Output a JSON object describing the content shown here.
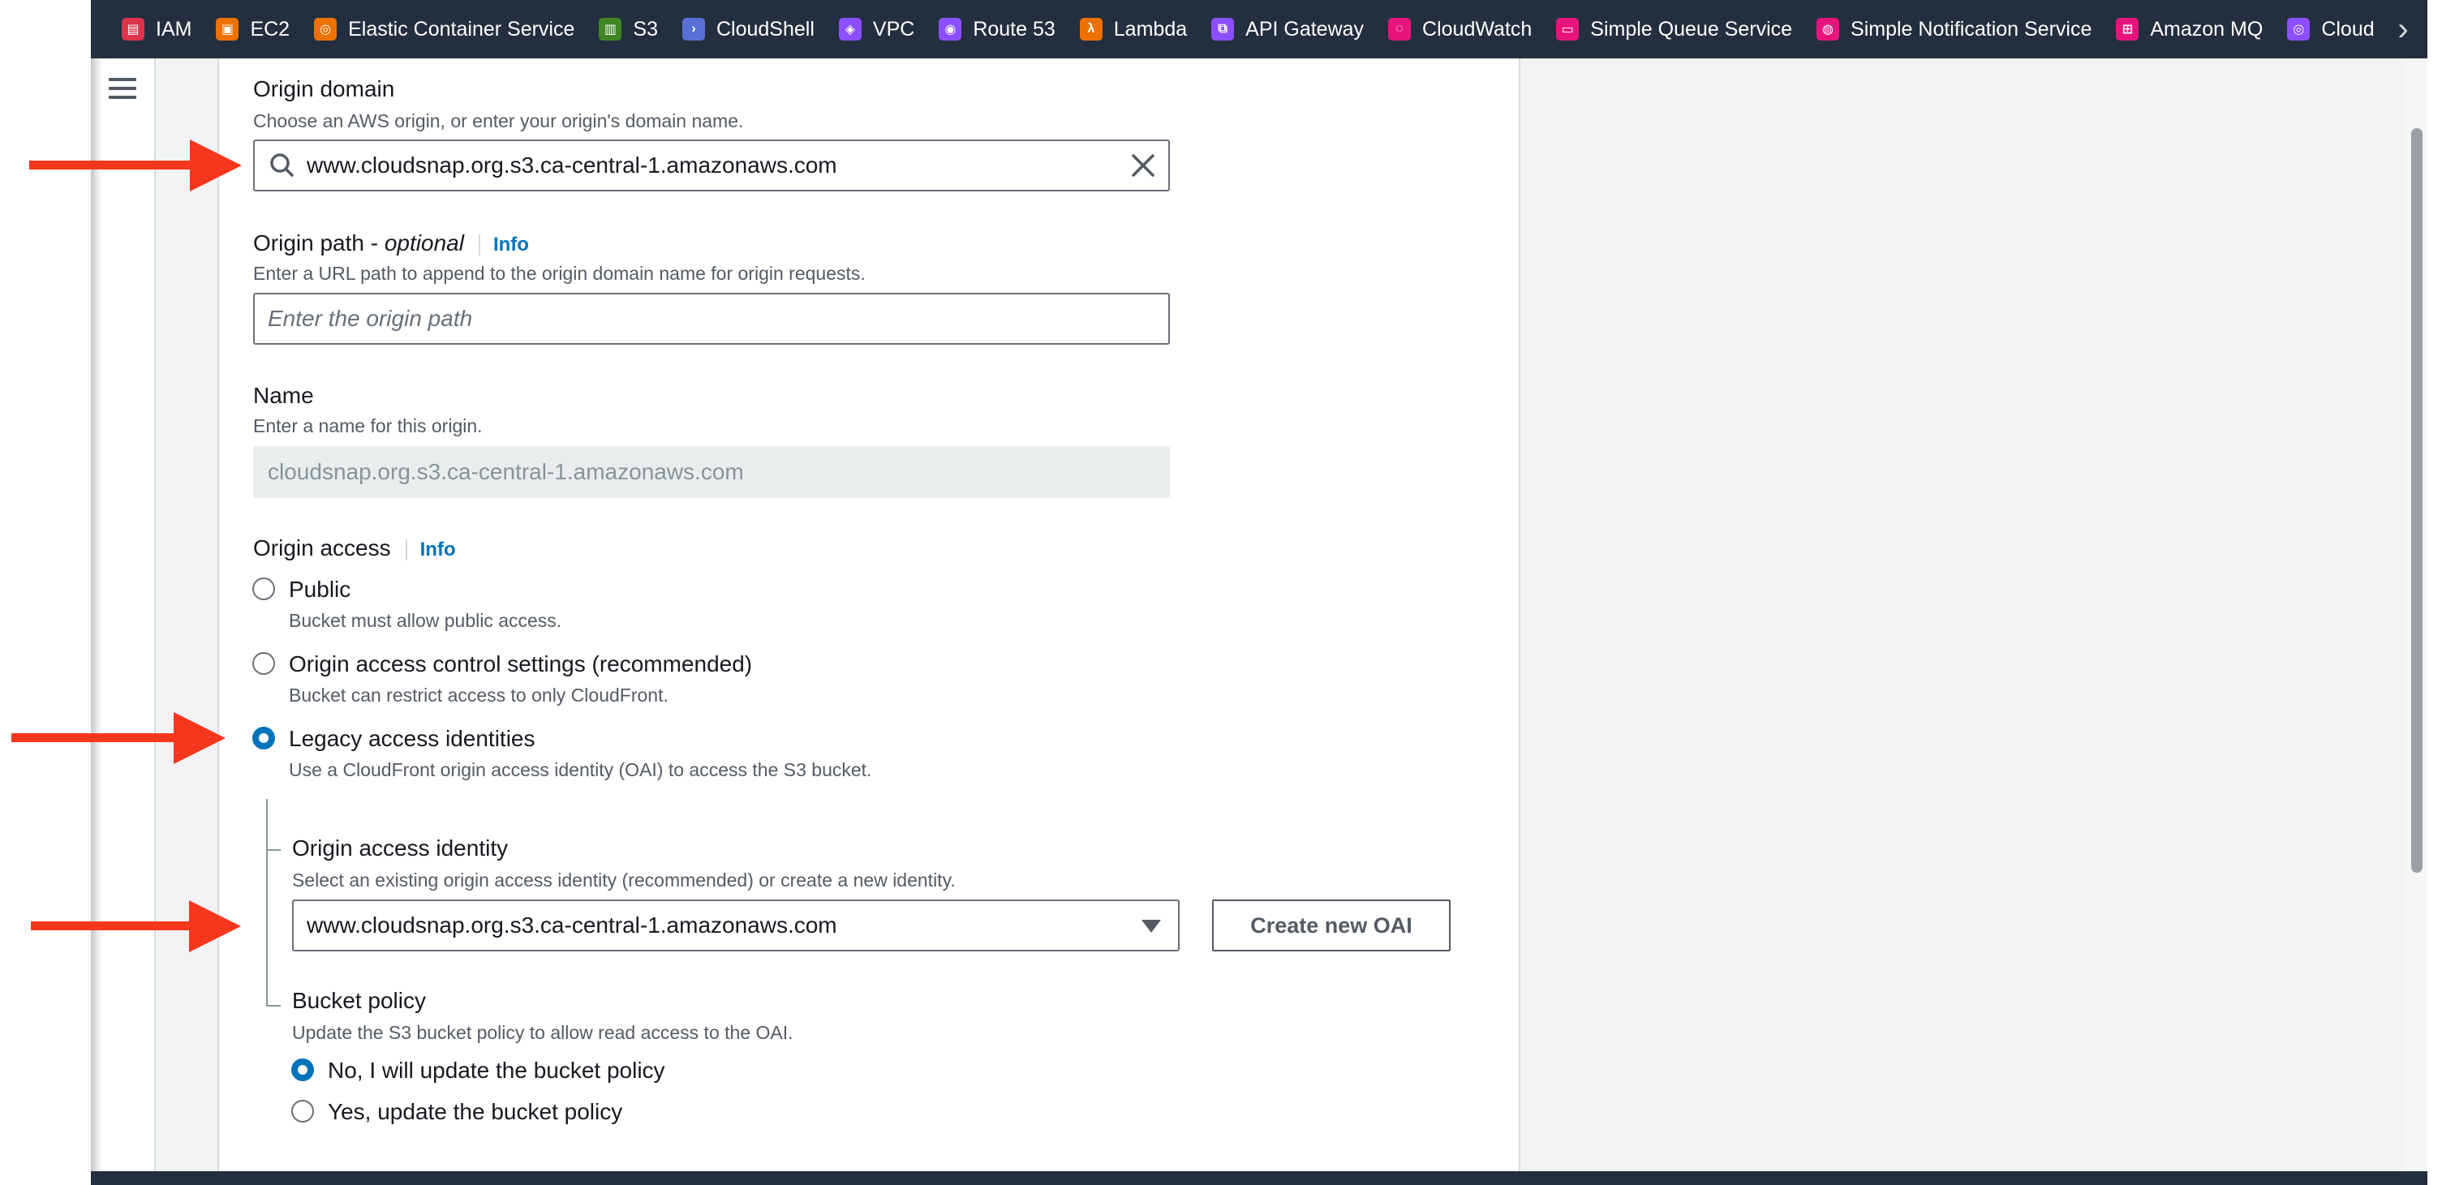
{
  "services": [
    {
      "label": "IAM",
      "icon": "iam-icon",
      "color": "#dd344c",
      "glyph": "▤"
    },
    {
      "label": "EC2",
      "icon": "ec2-icon",
      "color": "#ed7100",
      "glyph": "▣"
    },
    {
      "label": "Elastic Container Service",
      "icon": "ecs-icon",
      "color": "#ed7100",
      "glyph": "◎"
    },
    {
      "label": "S3",
      "icon": "s3-icon",
      "color": "#3f8624",
      "glyph": "▥"
    },
    {
      "label": "CloudShell",
      "icon": "cloudshell-icon",
      "color": "#5a6fd6",
      "glyph": "›"
    },
    {
      "label": "VPC",
      "icon": "vpc-icon",
      "color": "#8c4fff",
      "glyph": "◈"
    },
    {
      "label": "Route 53",
      "icon": "route53-icon",
      "color": "#8c4fff",
      "glyph": "◉"
    },
    {
      "label": "Lambda",
      "icon": "lambda-icon",
      "color": "#ed7100",
      "glyph": "λ"
    },
    {
      "label": "API Gateway",
      "icon": "api-gateway-icon",
      "color": "#8c4fff",
      "glyph": "⧉"
    },
    {
      "label": "CloudWatch",
      "icon": "cloudwatch-icon",
      "color": "#e7157b",
      "glyph": "◌"
    },
    {
      "label": "Simple Queue Service",
      "icon": "sqs-icon",
      "color": "#e7157b",
      "glyph": "▭"
    },
    {
      "label": "Simple Notification Service",
      "icon": "sns-icon",
      "color": "#e7157b",
      "glyph": "◍"
    },
    {
      "label": "Amazon MQ",
      "icon": "amazon-mq-icon",
      "color": "#e7157b",
      "glyph": "⊞"
    },
    {
      "label": "Cloud",
      "icon": "cloud-icon",
      "color": "#8c4fff",
      "glyph": "◎"
    }
  ],
  "form": {
    "origin_domain": {
      "label": "Origin domain",
      "description": "Choose an AWS origin, or enter your origin's domain name.",
      "value": "www.cloudsnap.org.s3.ca-central-1.amazonaws.com"
    },
    "origin_path": {
      "label": "Origin path - ",
      "label_optional": "optional",
      "info": "Info",
      "description": "Enter a URL path to append to the origin domain name for origin requests.",
      "placeholder": "Enter the origin path"
    },
    "name": {
      "label": "Name",
      "description": "Enter a name for this origin.",
      "value": "cloudsnap.org.s3.ca-central-1.amazonaws.com"
    },
    "origin_access": {
      "label": "Origin access",
      "info": "Info",
      "options": [
        {
          "label": "Public",
          "description": "Bucket must allow public access.",
          "selected": false
        },
        {
          "label": "Origin access control settings (recommended)",
          "description": "Bucket can restrict access to only CloudFront.",
          "selected": false
        },
        {
          "label": "Legacy access identities",
          "description": "Use a CloudFront origin access identity (OAI) to access the S3 bucket.",
          "selected": true
        }
      ]
    },
    "oai": {
      "label": "Origin access identity",
      "description": "Select an existing origin access identity (recommended) or create a new identity.",
      "value": "www.cloudsnap.org.s3.ca-central-1.amazonaws.com",
      "create_button": "Create new OAI"
    },
    "bucket_policy": {
      "label": "Bucket policy",
      "description": "Update the S3 bucket policy to allow read access to the OAI.",
      "options": [
        {
          "label": "No, I will update the bucket policy",
          "selected": true
        },
        {
          "label": "Yes, update the bucket policy",
          "selected": false
        }
      ]
    }
  },
  "colors": {
    "accent": "#0073bb",
    "annotation_arrow": "#f5371d",
    "topbar": "#232f3e"
  }
}
